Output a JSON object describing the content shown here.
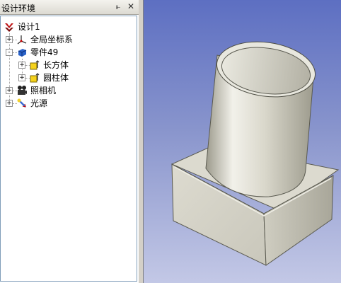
{
  "panel": {
    "title": "设计环境",
    "pin_icon": "pin-icon",
    "close_icon": "close-icon"
  },
  "tree": {
    "root": {
      "label": "设计1",
      "icon": "design-icon"
    },
    "items": [
      {
        "label": "全局坐标系",
        "icon": "axis-icon",
        "expander": "+"
      },
      {
        "label": "零件49",
        "icon": "part-icon",
        "expander": "-",
        "children": [
          {
            "label": "长方体",
            "icon": "feature-icon",
            "expander": "+"
          },
          {
            "label": "圆柱体",
            "icon": "feature-icon",
            "expander": "+"
          }
        ]
      },
      {
        "label": "照相机",
        "icon": "camera-icon",
        "expander": "+"
      },
      {
        "label": "光源",
        "icon": "light-icon",
        "expander": "+"
      }
    ]
  },
  "colors": {
    "viewport_top": "#5d6fc2",
    "viewport_bottom": "#c3c8e6",
    "model_face": "#e0ded3"
  }
}
